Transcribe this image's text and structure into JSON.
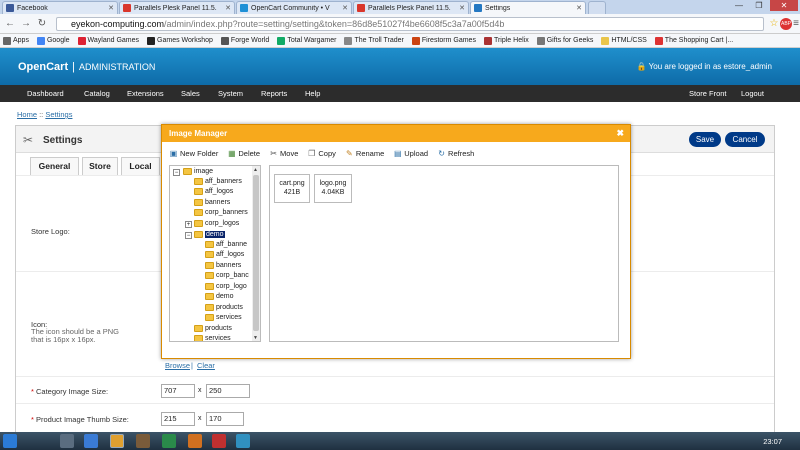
{
  "browser": {
    "tabs": [
      {
        "label": "Facebook",
        "color": "#3b5998"
      },
      {
        "label": "Parallels Plesk Panel 11.5.",
        "color": "#d9362b"
      },
      {
        "label": "OpenCart Community • V",
        "color": "#1e90d6"
      },
      {
        "label": "Parallels Plesk Panel 11.5.",
        "color": "#d9362b"
      },
      {
        "label": "Settings",
        "color": "#2478c2"
      }
    ],
    "url_host": "eyekon-computing.com",
    "url_path": "/admin/index.php?route=setting/setting&token=86d8e51027f4be6608f5c3a7a00f5d4b",
    "bookmarks": [
      {
        "label": "Apps",
        "color": "#666"
      },
      {
        "label": "Google",
        "color": "#4285f4"
      },
      {
        "label": "Wayland Games",
        "color": "#d23"
      },
      {
        "label": "Games Workshop",
        "color": "#222"
      },
      {
        "label": "Forge World",
        "color": "#555"
      },
      {
        "label": "Total Wargamer",
        "color": "#1a6"
      },
      {
        "label": "The Troll Trader",
        "color": "#888"
      },
      {
        "label": "Firestorm Games",
        "color": "#c41"
      },
      {
        "label": "Triple Helix",
        "color": "#a33"
      },
      {
        "label": "Gifts for Geeks",
        "color": "#777"
      },
      {
        "label": "HTML/CSS",
        "color": "#e9c54a"
      },
      {
        "label": "The Shopping Cart |...",
        "color": "#d33"
      }
    ]
  },
  "header": {
    "brand": "OpenCart",
    "separator": "|",
    "admin": "ADMINISTRATION",
    "logged_in": "You are logged in as estore_admin"
  },
  "menu": {
    "left": [
      "Dashboard",
      "Catalog",
      "Extensions",
      "Sales",
      "System",
      "Reports",
      "Help"
    ],
    "storefront": "Store Front",
    "logout": "Logout"
  },
  "breadcrumb": {
    "home": "Home",
    "sep": " :: ",
    "current": "Settings"
  },
  "page": {
    "title": "Settings",
    "save": "Save",
    "cancel": "Cancel",
    "tabs": [
      "General",
      "Store",
      "Local"
    ],
    "store_logo_label": "Store Logo:",
    "icon_label": "Icon:",
    "icon_help": "The icon should be a PNG that is 16px x 16px.",
    "browse": "Browse",
    "clear": "Clear",
    "category_size_label": "Category Image Size:",
    "category_w": "707",
    "category_h": "250",
    "thumb_size_label": "Product Image Thumb Size:",
    "thumb_w": "215",
    "thumb_h": "170",
    "x": "x",
    "req": "*"
  },
  "modal": {
    "title": "Image Manager",
    "close": "✖",
    "toolbar": [
      {
        "label": "New Folder",
        "icon": "new-folder-icon",
        "glyph": "▣",
        "color": "#2a6ea6"
      },
      {
        "label": "Delete",
        "icon": "delete-icon",
        "glyph": "▦",
        "color": "#4a8a3a"
      },
      {
        "label": "Move",
        "icon": "move-icon",
        "glyph": "✂",
        "color": "#444"
      },
      {
        "label": "Copy",
        "icon": "copy-icon",
        "glyph": "❐",
        "color": "#666"
      },
      {
        "label": "Rename",
        "icon": "rename-icon",
        "glyph": "✎",
        "color": "#c08020"
      },
      {
        "label": "Upload",
        "icon": "upload-icon",
        "glyph": "▤",
        "color": "#2a6ea6"
      },
      {
        "label": "Refresh",
        "icon": "refresh-icon",
        "glyph": "↻",
        "color": "#2a6ea6"
      }
    ],
    "tree": {
      "root": "image",
      "children": [
        "aff_banners",
        "aff_logos",
        "banners",
        "corp_banners",
        "corp_logos"
      ],
      "selected": "demo",
      "demo_children": [
        "aff_banne",
        "aff_logos",
        "banners",
        "corp_banc",
        "corp_logo",
        "demo",
        "products",
        "services"
      ],
      "after": [
        "products",
        "services"
      ],
      "expander_open": "−",
      "expander_closed": "+"
    },
    "files": [
      {
        "name": "cart.png",
        "size": "421B"
      },
      {
        "name": "logo.png",
        "size": "4.04KB"
      }
    ]
  },
  "taskbar": {
    "time": "23:07"
  }
}
